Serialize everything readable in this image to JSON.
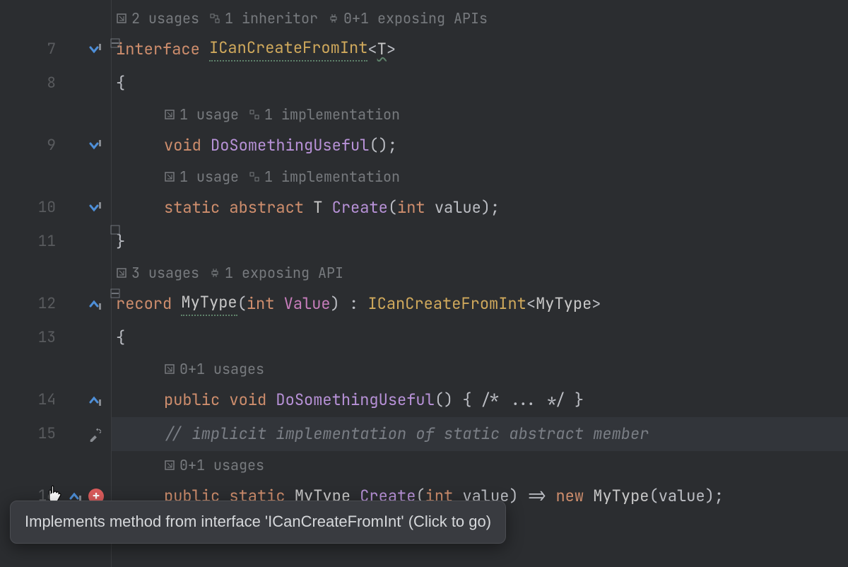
{
  "gutter": {
    "lines": [
      "7",
      "8",
      "9",
      "10",
      "11",
      "12",
      "13",
      "14",
      "15",
      "16"
    ]
  },
  "lens": {
    "l1_usages": "2 usages",
    "l1_inherit": "1 inheritor",
    "l1_api": "0+1 exposing APIs",
    "l2_usages": "1 usage",
    "l2_impl": "1 implementation",
    "l3_usages": "1 usage",
    "l3_impl": "1 implementation",
    "l4_usages": "3 usages",
    "l4_api": "1 exposing API",
    "l5_usages": "0+1 usages",
    "l6_usages": "0+1 usages"
  },
  "code": {
    "kw_interface": "interface ",
    "iface_name": "ICanCreateFromInt",
    "gen_open": "<",
    "gen_T": "T",
    "gen_close": ">",
    "brace_open": "{",
    "brace_close": "}",
    "kw_void": "void ",
    "m_doSomething": "DoSomethingUseful",
    "parens": "();",
    "kw_static": "static ",
    "kw_abstract": "abstract ",
    "type_T": "T ",
    "m_create": "Create",
    "p_open": "(",
    "kw_int": "int ",
    "p_value": "value",
    "p_close": ");",
    "kw_record": "record ",
    "type_MyType": "MyType",
    "rec_params_open": "(",
    "kw_int2": "int ",
    "prop_Value": "Value",
    "rec_params_close": ") : ",
    "iface_ref": "ICanCreateFromInt",
    "gen2_open": "<",
    "gen2_type": "MyType",
    "gen2_close": ">",
    "kw_public": "public ",
    "kw_void2": "void ",
    "body_stub": "() { /* ... */ }",
    "comment": "// implicit implementation of static abstract member",
    "kw_public2": "public ",
    "kw_static2": "static ",
    "ret_MyType": "MyType ",
    "m_create2": "Create",
    "p2_open": "(",
    "kw_int3": "int ",
    "p2_value": "value",
    "p2_close": ") ",
    "arrow": "=> ",
    "kw_new": "new ",
    "ctor_MyType": "MyType",
    "ctor_open": "(",
    "ctor_arg": "value",
    "ctor_close": ");"
  },
  "tooltip": "Implements method from interface 'ICanCreateFromInt' (Click to go)"
}
